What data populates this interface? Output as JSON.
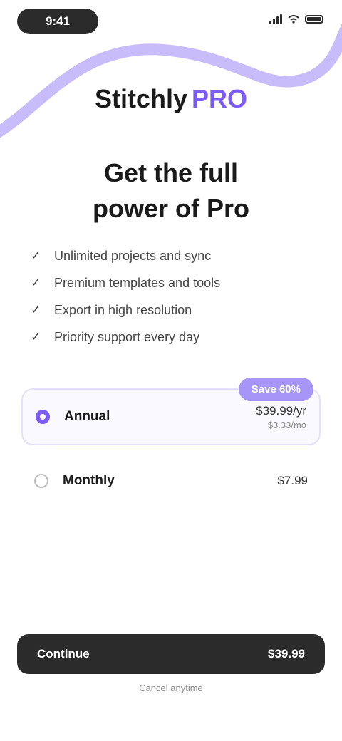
{
  "colors": {
    "accent": "#7c5cf6",
    "wave": "#c9bcfb",
    "dark": "#2b2b2b"
  },
  "status_bar": {
    "time": "9:41",
    "icons": [
      "signal-icon",
      "wifi-icon",
      "battery-icon"
    ]
  },
  "brand": {
    "name": "Stitchly",
    "badge": "PRO"
  },
  "headline": "Get the full\npower of Pro",
  "features": [
    "Unlimited projects and sync",
    "Premium templates and tools",
    "Export in high resolution",
    "Priority support every day"
  ],
  "plans": [
    {
      "name": "Annual",
      "price": "$39.99/yr",
      "sub": "$3.33/mo",
      "selected": true,
      "badge": "Save 60%"
    },
    {
      "name": "Monthly",
      "price": "$7.99",
      "sub": "",
      "selected": false
    }
  ],
  "cta": {
    "left": "Continue",
    "right": "$39.99"
  },
  "footnote": "Cancel anytime"
}
